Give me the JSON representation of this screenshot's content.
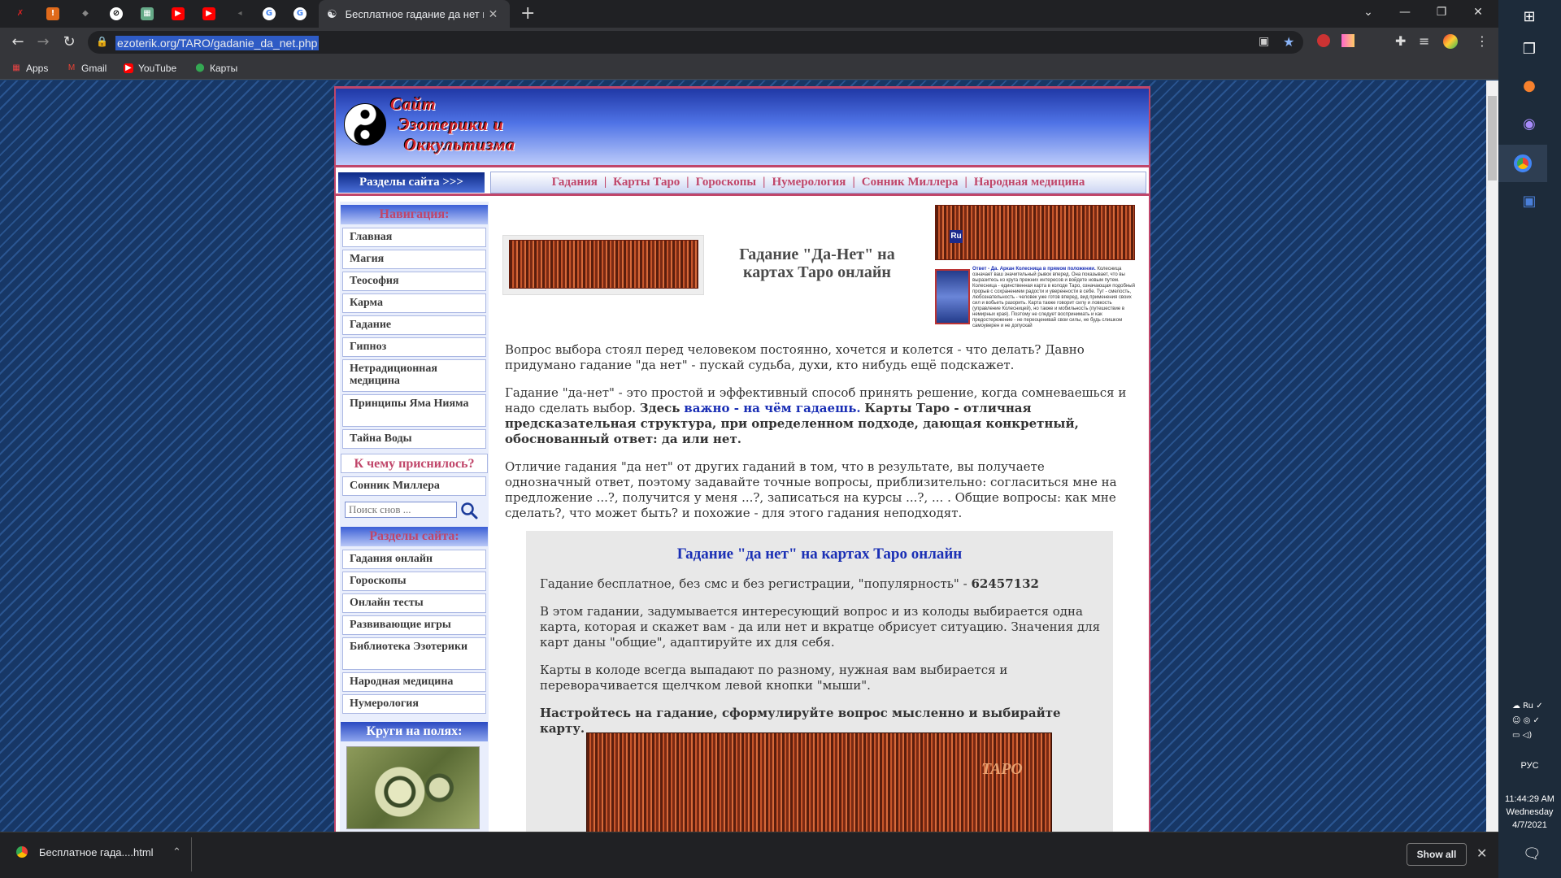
{
  "browser": {
    "active_tab_title": "Бесплатное гадание да нет на к",
    "url": "ezoterik.org/TARO/gadanie_da_net.php",
    "new_tab": "+",
    "bookmarks": [
      {
        "label": "Apps",
        "icon": "apps-grid-icon"
      },
      {
        "label": "Gmail",
        "icon": "gmail-icon"
      },
      {
        "label": "YouTube",
        "icon": "youtube-icon"
      },
      {
        "label": "Карты",
        "icon": "maps-icon"
      }
    ]
  },
  "site": {
    "logo_lines": [
      "Сайт",
      "Эзотерики и",
      "Оккультизма"
    ],
    "menu": {
      "sections_label": "Разделы сайта >>>",
      "links": [
        "Гадания",
        "Карты Таро",
        "Гороскопы",
        "Нумерология",
        "Сонник Миллера",
        "Народная медицина"
      ]
    },
    "sidebar": {
      "nav_heading": "Навигация:",
      "nav_items": [
        "Главная",
        "Магия",
        "Теософия",
        "Карма",
        "Гадание",
        "Гипноз",
        "Нетрадиционная медицина",
        "Принципы Яма Нияма",
        "Тайна Воды"
      ],
      "dream_heading": "К чему приснилось?",
      "dream_item": "Сонник Миллера",
      "dream_search_placeholder": "Поиск снов ...",
      "sections_heading": "Разделы сайта:",
      "section_items": [
        "Гадания онлайн",
        "Гороскопы",
        "Онлайн тесты",
        "Развивающие игры",
        "Библиотека Эзотерики",
        "Народная медицина",
        "Нумерология"
      ],
      "crop_heading": "Круги на полях:"
    },
    "content": {
      "title": "Гадание \"Да-Нет\" на картах Таро онлайн",
      "ru_badge": "Ru",
      "answer_snippet_lead": "Ответ - Да. Аркан Колесница в прямом положении.",
      "answer_snippet": "Колесница означает ваш значительный рывок вперед. Она показывает, что вы выразитесь из круга прежних интересов и войдете новым путем. Колесница - единственная карта в колоде Таро, означающая подобный прорыв с сохранением радости и уверенности в себе. Тут - смелость, любознательность - человек уже готов вперед, вид применения своих сил и вобьеть разорить. Карта также говорит силу и ловкость (управление Колесницей), но также и мобильность (путешествие в немирных края). Поэтому не следует воспринимать и как предостережение - не переоценивай свои силы, не будь слишком самоуверен и не допускай",
      "p1": "Вопрос выбора стоял перед человеком постоянно, хочется и колется - что делать? Давно придумано гадание \"да нет\" - пускай судьба, духи, кто нибудь ещё подскажет.",
      "p2_start": "Гадание \"да-нет\" - это простой и эффективный способ принять решение, когда сомневаешься и надо сделать выбор.",
      "p2_bold1": "Здесь",
      "p2_link": "важно - на чём гадаешь.",
      "p2_bold2": "Карты Таро - отличная предсказательная структура, при определенном подходе, дающая конкретный, обоснованный ответ: да или нет.",
      "p3": "Отличие гадания \"да нет\" от других гаданий в том, что в результате, вы получаете однозначный ответ, поэтому задавайте точные вопросы, приблизительно: согласиться мне на предложение ...?, получится у меня ...?, записаться на курсы ...?, ... . Общие вопросы: как мне сделать?, что может быть? и похожие - для этого гадания неподходят.",
      "game": {
        "title": "Гадание \"да нет\" на картах Таро онлайн",
        "popularity_text": "Гадание бесплатное, без смс и без регистрации, \"популярность\" -",
        "popularity_value": "62457132",
        "g1": "В этом гадании, задумывается интересующий вопрос и из колоды выбирается одна карта, которая и скажет вам - да или нет и вкратце обрисует ситуацию. Значения для карт даны \"общие\", адаптируйте их для себя.",
        "g2": "Карты в колоде всегда выпадают по разному, нужная вам выбирается и переворачивается щелчком левой кнопки \"мыши\".",
        "g3": "Настройтесь на гадание, сформулируйте вопрос мысленно и выбирайте карту.",
        "deck_label": "ТАРО"
      }
    }
  },
  "downloads": {
    "file": "Бесплатное гада....html",
    "show_all": "Show all"
  },
  "taskbar": {
    "lang": "РУС",
    "time": "11:44:29 AM",
    "day": "Wednesday",
    "date": "4/7/2021"
  }
}
